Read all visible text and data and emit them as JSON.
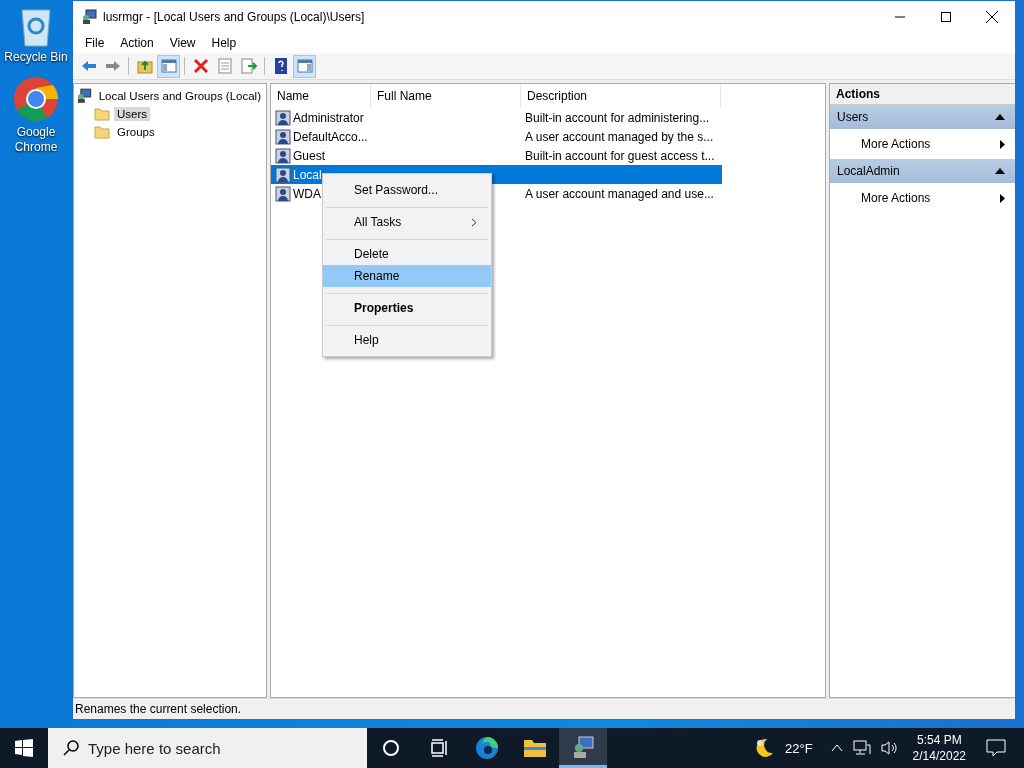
{
  "desktop_icons": [
    {
      "kind": "recycle",
      "label": "Recycle Bin"
    },
    {
      "kind": "chrome",
      "label": "Google Chrome"
    }
  ],
  "window": {
    "title": "lusrmgr - [Local Users and Groups (Local)\\Users]",
    "menu": [
      "File",
      "Action",
      "View",
      "Help"
    ],
    "toolbar": [
      {
        "kind": "back",
        "pressed": false
      },
      {
        "kind": "forward",
        "pressed": false
      },
      {
        "kind": "up",
        "pressed": false
      },
      {
        "kind": "tree",
        "pressed": true
      },
      {
        "kind": "delete",
        "pressed": false
      },
      {
        "kind": "properties",
        "pressed": false
      },
      {
        "kind": "export",
        "pressed": false
      },
      {
        "kind": "help",
        "pressed": false
      },
      {
        "kind": "actions",
        "pressed": true
      }
    ],
    "tree": [
      {
        "label": "Local Users and Groups (Local)",
        "selected": false,
        "children": [
          {
            "label": "Users",
            "selected": true
          },
          {
            "label": "Groups",
            "selected": false
          }
        ]
      }
    ],
    "list": {
      "columns": [
        "Name",
        "Full Name",
        "Description"
      ],
      "rows": [
        {
          "name": "Administrator",
          "full_name": "",
          "description": "Built-in account for administering...",
          "selected": false
        },
        {
          "name": "DefaultAcco...",
          "full_name": "",
          "description": "A user account managed by the s...",
          "selected": false
        },
        {
          "name": "Guest",
          "full_name": "",
          "description": "Built-in account for guest access t...",
          "selected": false
        },
        {
          "name": "Local",
          "full_name": "",
          "description": "",
          "selected": true
        },
        {
          "name": "WDA",
          "full_name": "",
          "description": "A user account managed and use...",
          "selected": false
        }
      ]
    },
    "context_menu": [
      [
        {
          "label": "Set Password...",
          "bold": false,
          "submenu": false,
          "selected": false
        }
      ],
      [
        {
          "label": "All Tasks",
          "bold": false,
          "submenu": true,
          "selected": false
        }
      ],
      [
        {
          "label": "Delete",
          "bold": false,
          "submenu": false,
          "selected": false
        },
        {
          "label": "Rename",
          "bold": false,
          "submenu": false,
          "selected": true
        }
      ],
      [
        {
          "label": "Properties",
          "bold": true,
          "submenu": false,
          "selected": false
        }
      ],
      [
        {
          "label": "Help",
          "bold": false,
          "submenu": false,
          "selected": false
        }
      ]
    ],
    "actions": {
      "title": "Actions",
      "sections": [
        {
          "title": "Users",
          "expanded": true,
          "items": [
            "More Actions"
          ]
        },
        {
          "title": "LocalAdmin",
          "expanded": true,
          "items": [
            "More Actions"
          ]
        }
      ]
    },
    "status_bar": "Renames the current selection."
  },
  "taskbar": {
    "search_placeholder": "Type here to search",
    "apps": [
      {
        "kind": "cortana",
        "active": false
      },
      {
        "kind": "taskview",
        "active": false
      },
      {
        "kind": "edge",
        "active": false
      },
      {
        "kind": "explorer",
        "active": false
      },
      {
        "kind": "lusrmgr",
        "active": true
      }
    ],
    "temperature": "22°F",
    "time": "5:54 PM",
    "date": "2/14/2022"
  }
}
